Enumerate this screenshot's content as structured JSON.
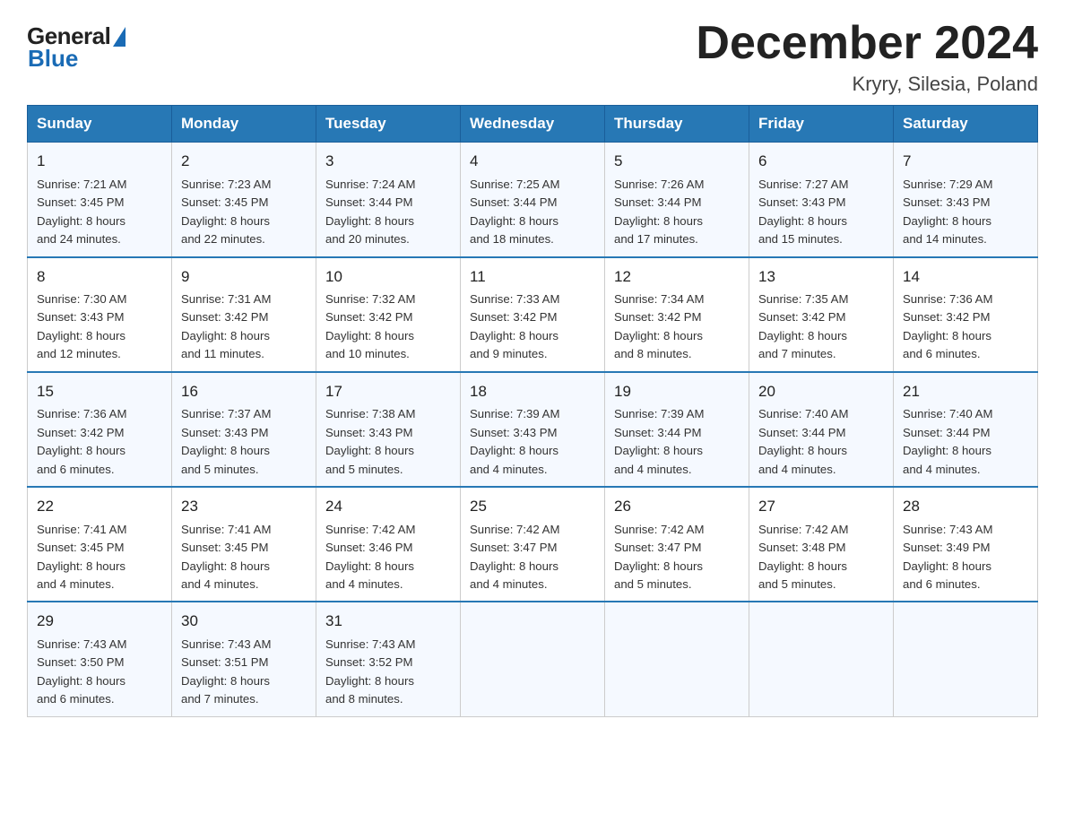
{
  "header": {
    "logo": {
      "general": "General",
      "blue": "Blue"
    },
    "title": "December 2024",
    "location": "Kryry, Silesia, Poland"
  },
  "days_of_week": [
    "Sunday",
    "Monday",
    "Tuesday",
    "Wednesday",
    "Thursday",
    "Friday",
    "Saturday"
  ],
  "weeks": [
    [
      {
        "day": "1",
        "sunrise": "7:21 AM",
        "sunset": "3:45 PM",
        "daylight": "8 hours and 24 minutes."
      },
      {
        "day": "2",
        "sunrise": "7:23 AM",
        "sunset": "3:45 PM",
        "daylight": "8 hours and 22 minutes."
      },
      {
        "day": "3",
        "sunrise": "7:24 AM",
        "sunset": "3:44 PM",
        "daylight": "8 hours and 20 minutes."
      },
      {
        "day": "4",
        "sunrise": "7:25 AM",
        "sunset": "3:44 PM",
        "daylight": "8 hours and 18 minutes."
      },
      {
        "day": "5",
        "sunrise": "7:26 AM",
        "sunset": "3:44 PM",
        "daylight": "8 hours and 17 minutes."
      },
      {
        "day": "6",
        "sunrise": "7:27 AM",
        "sunset": "3:43 PM",
        "daylight": "8 hours and 15 minutes."
      },
      {
        "day": "7",
        "sunrise": "7:29 AM",
        "sunset": "3:43 PM",
        "daylight": "8 hours and 14 minutes."
      }
    ],
    [
      {
        "day": "8",
        "sunrise": "7:30 AM",
        "sunset": "3:43 PM",
        "daylight": "8 hours and 12 minutes."
      },
      {
        "day": "9",
        "sunrise": "7:31 AM",
        "sunset": "3:42 PM",
        "daylight": "8 hours and 11 minutes."
      },
      {
        "day": "10",
        "sunrise": "7:32 AM",
        "sunset": "3:42 PM",
        "daylight": "8 hours and 10 minutes."
      },
      {
        "day": "11",
        "sunrise": "7:33 AM",
        "sunset": "3:42 PM",
        "daylight": "8 hours and 9 minutes."
      },
      {
        "day": "12",
        "sunrise": "7:34 AM",
        "sunset": "3:42 PM",
        "daylight": "8 hours and 8 minutes."
      },
      {
        "day": "13",
        "sunrise": "7:35 AM",
        "sunset": "3:42 PM",
        "daylight": "8 hours and 7 minutes."
      },
      {
        "day": "14",
        "sunrise": "7:36 AM",
        "sunset": "3:42 PM",
        "daylight": "8 hours and 6 minutes."
      }
    ],
    [
      {
        "day": "15",
        "sunrise": "7:36 AM",
        "sunset": "3:42 PM",
        "daylight": "8 hours and 6 minutes."
      },
      {
        "day": "16",
        "sunrise": "7:37 AM",
        "sunset": "3:43 PM",
        "daylight": "8 hours and 5 minutes."
      },
      {
        "day": "17",
        "sunrise": "7:38 AM",
        "sunset": "3:43 PM",
        "daylight": "8 hours and 5 minutes."
      },
      {
        "day": "18",
        "sunrise": "7:39 AM",
        "sunset": "3:43 PM",
        "daylight": "8 hours and 4 minutes."
      },
      {
        "day": "19",
        "sunrise": "7:39 AM",
        "sunset": "3:44 PM",
        "daylight": "8 hours and 4 minutes."
      },
      {
        "day": "20",
        "sunrise": "7:40 AM",
        "sunset": "3:44 PM",
        "daylight": "8 hours and 4 minutes."
      },
      {
        "day": "21",
        "sunrise": "7:40 AM",
        "sunset": "3:44 PM",
        "daylight": "8 hours and 4 minutes."
      }
    ],
    [
      {
        "day": "22",
        "sunrise": "7:41 AM",
        "sunset": "3:45 PM",
        "daylight": "8 hours and 4 minutes."
      },
      {
        "day": "23",
        "sunrise": "7:41 AM",
        "sunset": "3:45 PM",
        "daylight": "8 hours and 4 minutes."
      },
      {
        "day": "24",
        "sunrise": "7:42 AM",
        "sunset": "3:46 PM",
        "daylight": "8 hours and 4 minutes."
      },
      {
        "day": "25",
        "sunrise": "7:42 AM",
        "sunset": "3:47 PM",
        "daylight": "8 hours and 4 minutes."
      },
      {
        "day": "26",
        "sunrise": "7:42 AM",
        "sunset": "3:47 PM",
        "daylight": "8 hours and 5 minutes."
      },
      {
        "day": "27",
        "sunrise": "7:42 AM",
        "sunset": "3:48 PM",
        "daylight": "8 hours and 5 minutes."
      },
      {
        "day": "28",
        "sunrise": "7:43 AM",
        "sunset": "3:49 PM",
        "daylight": "8 hours and 6 minutes."
      }
    ],
    [
      {
        "day": "29",
        "sunrise": "7:43 AM",
        "sunset": "3:50 PM",
        "daylight": "8 hours and 6 minutes."
      },
      {
        "day": "30",
        "sunrise": "7:43 AM",
        "sunset": "3:51 PM",
        "daylight": "8 hours and 7 minutes."
      },
      {
        "day": "31",
        "sunrise": "7:43 AM",
        "sunset": "3:52 PM",
        "daylight": "8 hours and 8 minutes."
      },
      null,
      null,
      null,
      null
    ]
  ],
  "labels": {
    "sunrise": "Sunrise:",
    "sunset": "Sunset:",
    "daylight": "Daylight:"
  }
}
